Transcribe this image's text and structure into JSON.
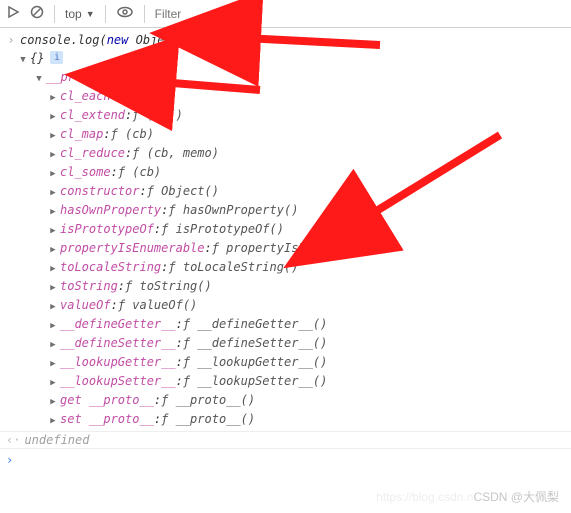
{
  "toolbar": {
    "context": "top",
    "filter_placeholder": "Filter"
  },
  "console": {
    "call_prefix": "console.log(",
    "new_kw": "new",
    "obj_type": " Object",
    "call_suffix": ")",
    "result_header": "{}",
    "proto_label": "__proto__",
    "entries": [
      {
        "name": "cl_each",
        "sig": "ƒ (cb)"
      },
      {
        "name": "cl_extend",
        "sig": "ƒ (obj)"
      },
      {
        "name": "cl_map",
        "sig": "ƒ (cb)"
      },
      {
        "name": "cl_reduce",
        "sig": "ƒ (cb, memo)"
      },
      {
        "name": "cl_some",
        "sig": "ƒ (cb)"
      },
      {
        "name": "constructor",
        "sig": "ƒ Object()"
      },
      {
        "name": "hasOwnProperty",
        "sig": "ƒ hasOwnProperty()"
      },
      {
        "name": "isPrototypeOf",
        "sig": "ƒ isPrototypeOf()"
      },
      {
        "name": "propertyIsEnumerable",
        "sig": "ƒ propertyIsEnumerable()"
      },
      {
        "name": "toLocaleString",
        "sig": "ƒ toLocaleString()"
      },
      {
        "name": "toString",
        "sig": "ƒ toString()"
      },
      {
        "name": "valueOf",
        "sig": "ƒ valueOf()"
      },
      {
        "name": "__defineGetter__",
        "sig": "ƒ __defineGetter__()"
      },
      {
        "name": "__defineSetter__",
        "sig": "ƒ __defineSetter__()"
      },
      {
        "name": "__lookupGetter__",
        "sig": "ƒ __lookupGetter__()"
      },
      {
        "name": "__lookupSetter__",
        "sig": "ƒ __lookupSetter__()"
      },
      {
        "name": "get __proto__",
        "sig": "ƒ __proto__()"
      },
      {
        "name": "set __proto__",
        "sig": "ƒ __proto__()"
      }
    ],
    "undefined_label": "undefined"
  },
  "watermark": {
    "faint": "https://blog.csdn.n",
    "main": "CSDN @大佩梨"
  }
}
